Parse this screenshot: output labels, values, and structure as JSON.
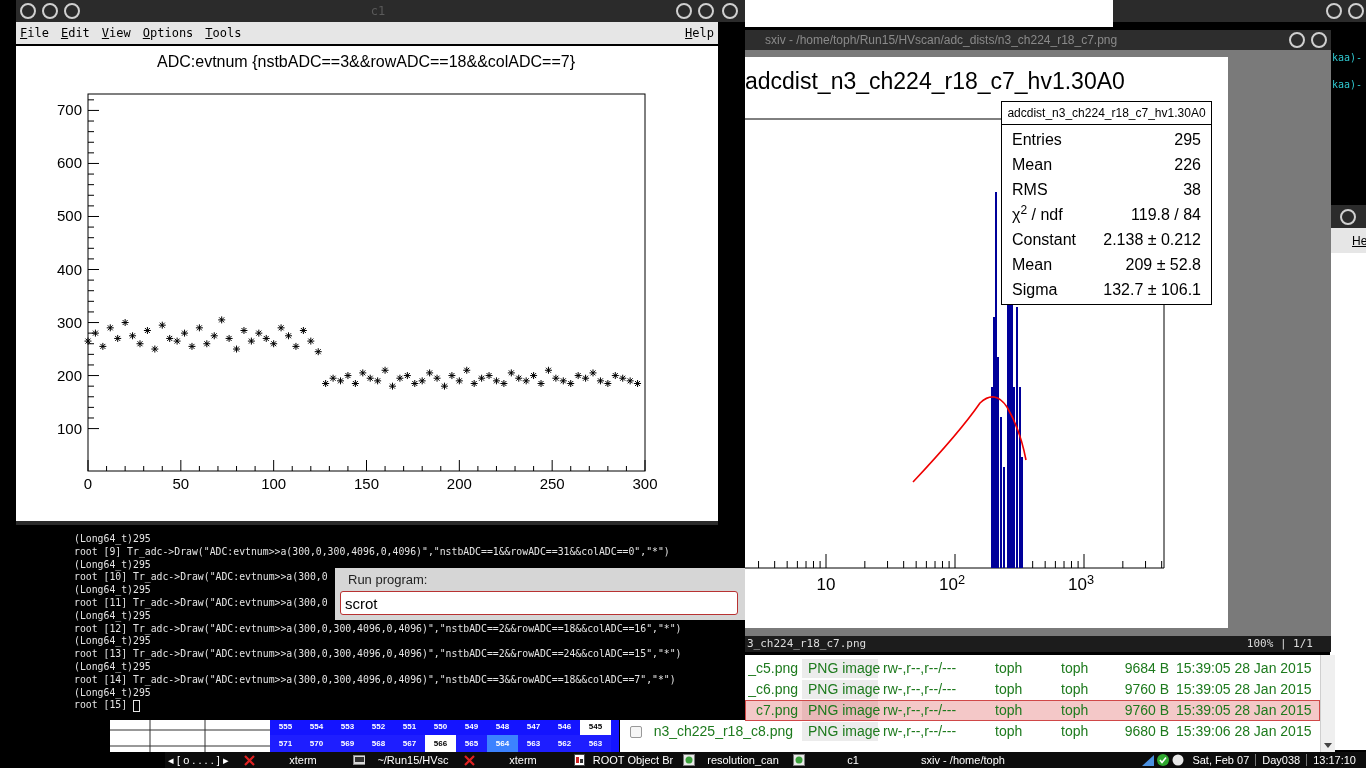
{
  "c1_window": {
    "title": "c1",
    "menu": [
      {
        "label": "File"
      },
      {
        "label": "Edit"
      },
      {
        "label": "View"
      },
      {
        "label": "Options"
      },
      {
        "label": "Tools"
      }
    ],
    "help": "Help",
    "chart_data": {
      "type": "scatter",
      "title": "ADC:evtnum {nstbADC==3&&rowADC==18&&colADC==7}",
      "xlim": [
        0,
        300
      ],
      "ylim": [
        20,
        731
      ],
      "xticks": [
        0,
        50,
        100,
        150,
        200,
        250,
        300
      ],
      "yticks": [
        100,
        200,
        300,
        400,
        500,
        600,
        700
      ],
      "x": [
        0,
        4,
        8,
        12,
        16,
        20,
        24,
        28,
        32,
        36,
        40,
        44,
        48,
        52,
        56,
        60,
        64,
        68,
        72,
        76,
        80,
        84,
        88,
        92,
        96,
        100,
        104,
        108,
        112,
        116,
        120,
        124,
        128,
        132,
        136,
        140,
        144,
        148,
        152,
        156,
        160,
        164,
        168,
        172,
        176,
        180,
        184,
        188,
        192,
        196,
        200,
        204,
        208,
        212,
        216,
        220,
        224,
        228,
        232,
        236,
        240,
        244,
        248,
        252,
        256,
        260,
        264,
        268,
        272,
        276,
        280,
        284,
        288,
        292,
        296
      ],
      "series": [
        {
          "color": "#000000",
          "values": [
            265,
            280,
            255,
            290,
            270,
            300,
            275,
            260,
            285,
            250,
            295,
            270,
            265,
            280,
            255,
            290,
            260,
            275,
            305,
            270,
            250,
            285,
            265,
            280,
            270,
            260,
            290,
            275,
            255,
            285,
            265,
            245,
            185,
            195,
            190,
            200,
            185,
            205,
            195,
            190,
            210,
            180,
            195,
            200,
            185,
            190,
            205,
            195,
            180,
            200,
            190,
            210,
            185,
            195,
            200,
            190,
            185,
            205,
            195,
            190,
            200,
            185,
            210,
            195,
            190,
            185,
            200,
            195,
            205,
            190,
            185,
            200,
            195,
            190,
            185
          ]
        }
      ]
    }
  },
  "sxiv_window": {
    "title": "sxiv - /home/toph/Run15/HVscan/adc_dists/n3_ch224_r18_c7.png",
    "image": {
      "title": "adcdist_n3_ch224_r18_c7_hv1.30A0",
      "stats": {
        "title": "adcdist_n3_ch224_r18_c7_hv1.30A0",
        "rows": [
          {
            "label": "Entries",
            "value": "295"
          },
          {
            "label": "Mean",
            "value": "226"
          },
          {
            "label": "RMS",
            "value": "38"
          },
          {
            "label": "χ$^{2}$ / ndf",
            "value": "119.8 / 84"
          },
          {
            "label": "Constant",
            "value": "2.138 ± 0.212"
          },
          {
            "label": "Mean",
            "value": "209 ± 52.8"
          },
          {
            "label": "Sigma",
            "value": "132.7 ± 106.1"
          }
        ]
      },
      "axis_labels": [
        "10",
        "10$^{2}$",
        "10$^{3}$"
      ]
    },
    "status": {
      "file": "3_ch224_r18_c7.png",
      "zoom": "100% | 1/1"
    }
  },
  "terminal": {
    "lines": [
      "(Long64_t)295",
      "root [9] Tr_adc->Draw(\"ADC:evtnum>>a(300,0,300,4096,0,4096)\",\"nstbADC==1&&rowADC==31&&colADC==0\",\"*\")",
      "(Long64_t)295",
      "root [10] Tr_adc->Draw(\"ADC:evtnum>>a(300,0",
      "(Long64_t)295",
      "root [11] Tr_adc->Draw(\"ADC:evtnum>>a(300,0",
      "(Long64_t)295",
      "root [12] Tr_adc->Draw(\"ADC:evtnum>>a(300,0,300,4096,0,4096)\",\"nstbADC==2&&rowADC==18&&colADC==16\",\"*\")",
      "(Long64_t)295",
      "root [13] Tr_adc->Draw(\"ADC:evtnum>>a(300,0,300,4096,0,4096)\",\"nstbADC==2&&rowADC==24&&colADC==15\",\"*\")",
      "(Long64_t)295",
      "root [14] Tr_adc->Draw(\"ADC:evtnum>>a(300,0,300,4096,0,4096)\",\"nstbADC==3&&rowADC==18&&colADC==7\",\"*\")",
      "(Long64_t)295"
    ],
    "prompt": "root [15]"
  },
  "run_dialog": {
    "label": "Run program:",
    "value": "scrot"
  },
  "file_list": {
    "rows": [
      {
        "kind": "clipped",
        "name": "_c5.png",
        "type": "PNG image",
        "permissions": "rw-,r--,r--/---",
        "owner": "toph",
        "group": "toph",
        "size": "9684 B",
        "date": "15:39:05 28 Jan 2015",
        "selected": false
      },
      {
        "kind": "clipped",
        "name": "_c6.png",
        "type": "PNG image",
        "permissions": "rw-,r--,r--/---",
        "owner": "toph",
        "group": "toph",
        "size": "9760 B",
        "date": "15:39:05 28 Jan 2015",
        "selected": false
      },
      {
        "kind": "clipped",
        "name": "c7.png",
        "type": "PNG image",
        "permissions": "rw-,r--,r--/---",
        "owner": "toph",
        "group": "toph",
        "size": "9760 B",
        "date": "15:39:05 28 Jan 2015",
        "selected": true
      },
      {
        "kind": "checkbox-row",
        "name": "n3_ch225_r18_c8.png",
        "type": "PNG image",
        "permissions": "rw-,r--,r--/---",
        "owner": "toph",
        "group": "toph",
        "size": "9680 B",
        "date": "15:39:06 28 Jan 2015",
        "selected": false
      }
    ]
  },
  "side_xterm": {
    "lines": [
      "kaa)-",
      "kaa)-"
    ]
  },
  "side_window": {
    "menu": "He"
  },
  "grid": {
    "rows": [
      [
        {
          "label": "555",
          "color": "#1414ff"
        },
        {
          "label": "554",
          "color": "#1414ff"
        },
        {
          "label": "553",
          "color": "#1414ff"
        },
        {
          "label": "552",
          "color": "#1414ff"
        },
        {
          "label": "551",
          "color": "#1414ff"
        },
        {
          "label": "550",
          "color": "#1414ff"
        },
        {
          "label": "549",
          "color": "#1414ff"
        },
        {
          "label": "548",
          "color": "#1414ff"
        },
        {
          "label": "547",
          "color": "#1414ff"
        },
        {
          "label": "546",
          "color": "#1414ff"
        },
        {
          "label": "545",
          "color": "#ffffff"
        }
      ],
      [
        {
          "label": "571",
          "color": "#1e1eff"
        },
        {
          "label": "570",
          "color": "#1e1eff"
        },
        {
          "label": "569",
          "color": "#1e1eff"
        },
        {
          "label": "568",
          "color": "#1e1eff"
        },
        {
          "label": "567",
          "color": "#1e1eff"
        },
        {
          "label": "566",
          "color": "#ffffff"
        },
        {
          "label": "565",
          "color": "#1e1eff"
        },
        {
          "label": "564",
          "color": "#3c82ff"
        },
        {
          "label": "563",
          "color": "#1e1eff"
        },
        {
          "label": "562",
          "color": "#1e1eff"
        },
        {
          "label": "563",
          "color": "#1e1eff"
        }
      ]
    ]
  },
  "taskbar": {
    "pager": "◂ [ o . . . . ] ▸",
    "items": [
      {
        "label": "xterm",
        "kind": "x"
      },
      {
        "label": "~/Run15/HVsc",
        "kind": "terminal"
      },
      {
        "label": "xterm",
        "kind": "x"
      },
      {
        "label": "ROOT Object Br",
        "kind": "root"
      },
      {
        "label": "resolution_can",
        "kind": "image"
      },
      {
        "label": "c1",
        "kind": "image"
      },
      {
        "label": "sxiv - /home/toph",
        "kind": "plain"
      }
    ],
    "clock": [
      "Sat, Feb 07",
      "Day038",
      "13:17:10"
    ]
  }
}
